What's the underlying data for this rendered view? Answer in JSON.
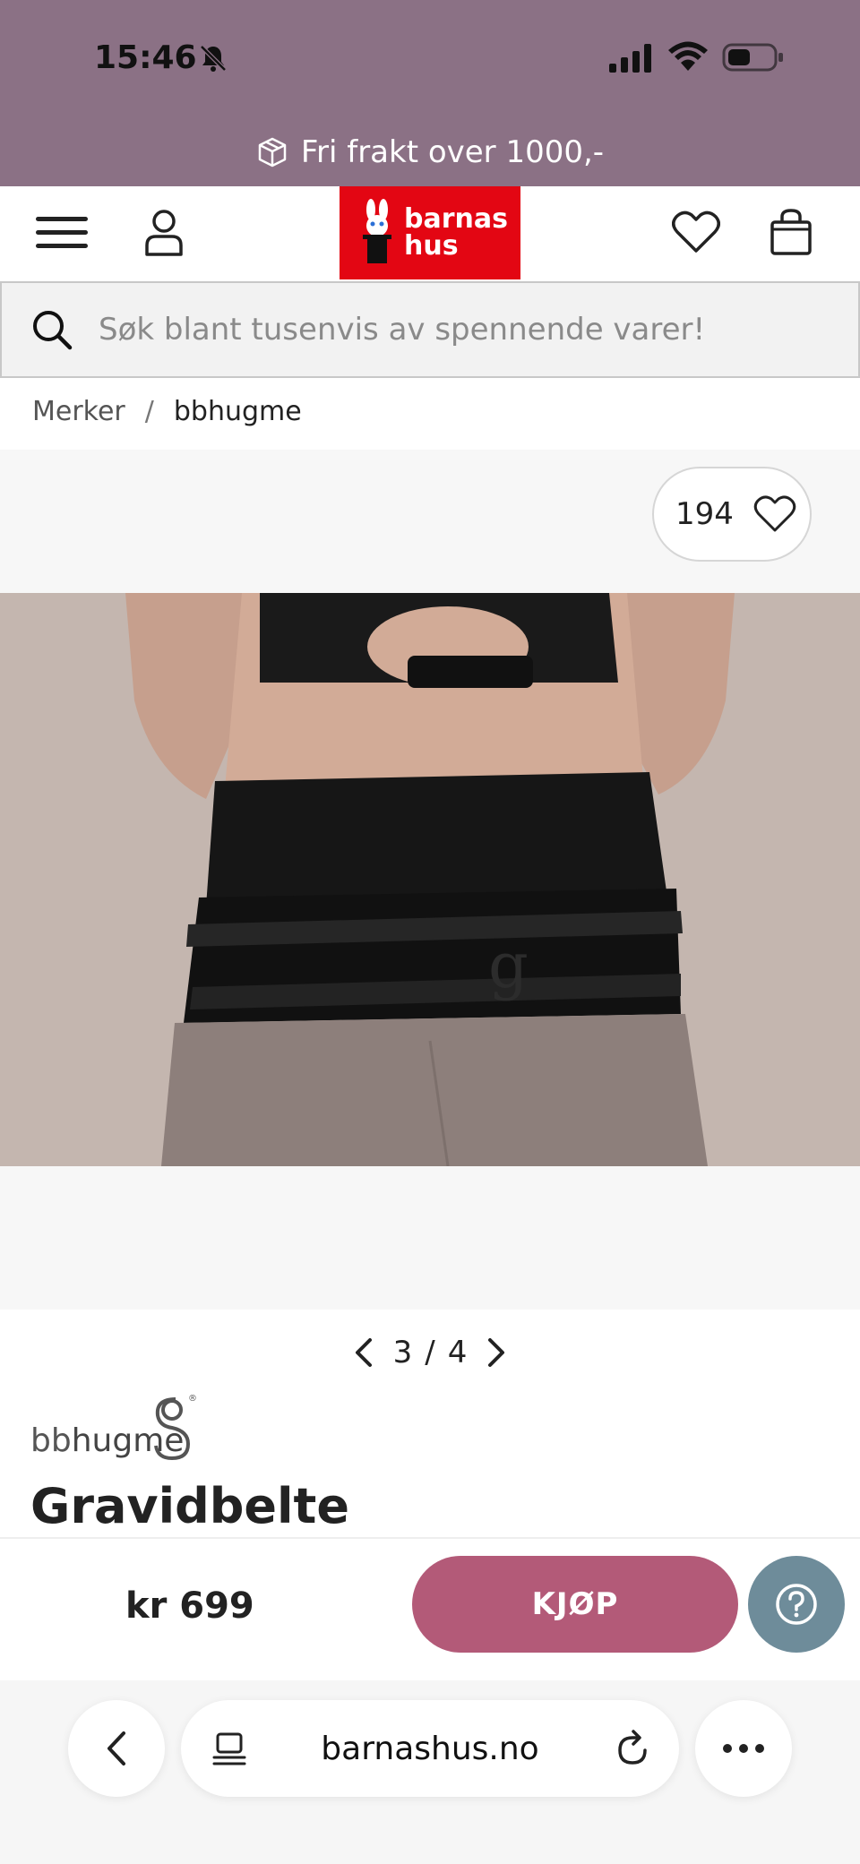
{
  "status_bar": {
    "time": "15:46"
  },
  "promo": {
    "text": "Fri frakt over 1000,-"
  },
  "header": {
    "logo_line1": "barnas",
    "logo_line2": "hus"
  },
  "search": {
    "placeholder": "Søk blant tusenvis av spennende varer!"
  },
  "breadcrumb": {
    "items": [
      "Merker",
      "bbhugme"
    ],
    "separator": "/"
  },
  "gallery": {
    "likes": "194",
    "current": "3",
    "separator": "/",
    "total": "4"
  },
  "product": {
    "brand_part1": "bb",
    "brand_part2": "hugme",
    "title": "Gravidbelte",
    "price": "kr 699",
    "buy_label": "KJØP"
  },
  "browser": {
    "url": "barnashus.no"
  },
  "colors": {
    "topband": "#8b7185",
    "logo_red": "#e30613",
    "buy_button": "#b35a78",
    "help_button": "#6e8c9a"
  }
}
